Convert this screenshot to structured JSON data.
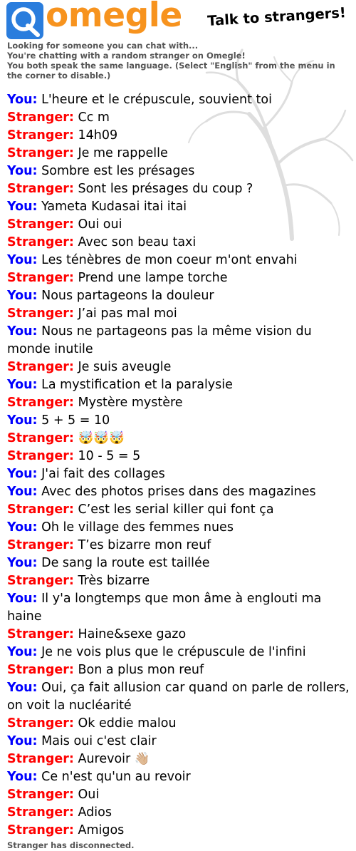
{
  "brand": {
    "name": "omegle",
    "tagline": "Talk to strangers!",
    "logo_icon": "omegle-logo-icon",
    "colors": {
      "logo_blue": "#2a7ddd",
      "logo_orange": "#f7931e",
      "you": "#0000ff",
      "stranger": "#ff0000",
      "status": "#555555"
    }
  },
  "status": {
    "line1": "Looking for someone you can chat with...",
    "line2": "You're chatting with a random stranger on Omegle!",
    "line3": "You both speak the same language. (Select \"English\" from the menu in the corner to disable.)",
    "disconnected": "Stranger has disconnected."
  },
  "chat": [
    {
      "who": "You:",
      "role": "you",
      "text": "L'heure et le crépuscule, souvient toi"
    },
    {
      "who": "Stranger:",
      "role": "stranger",
      "text": "Cc m"
    },
    {
      "who": "Stranger:",
      "role": "stranger",
      "text": "14h09"
    },
    {
      "who": "Stranger:",
      "role": "stranger",
      "text": "Je me rappelle"
    },
    {
      "who": "You:",
      "role": "you",
      "text": "Sombre est les présages"
    },
    {
      "who": "Stranger:",
      "role": "stranger",
      "text": "Sont les présages du coup ?"
    },
    {
      "who": "You:",
      "role": "you",
      "text": "Yameta Kudasai itai itai"
    },
    {
      "who": "Stranger:",
      "role": "stranger",
      "text": "Oui oui"
    },
    {
      "who": "Stranger:",
      "role": "stranger",
      "text": "Avec son beau taxi"
    },
    {
      "who": "You:",
      "role": "you",
      "text": "Les ténèbres de mon coeur m'ont envahi"
    },
    {
      "who": "Stranger:",
      "role": "stranger",
      "text": "Prend une lampe torche"
    },
    {
      "who": "You:",
      "role": "you",
      "text": "Nous partageons la douleur"
    },
    {
      "who": "Stranger:",
      "role": "stranger",
      "text": "J’ai pas mal moi"
    },
    {
      "who": "You:",
      "role": "you",
      "text": "Nous ne partageons pas la même vision du monde inutile"
    },
    {
      "who": "Stranger:",
      "role": "stranger",
      "text": "Je suis aveugle"
    },
    {
      "who": "You:",
      "role": "you",
      "text": "La mystification et la paralysie"
    },
    {
      "who": "Stranger:",
      "role": "stranger",
      "text": "Mystère mystère"
    },
    {
      "who": "You:",
      "role": "you",
      "text": "5 + 5 = 10"
    },
    {
      "who": "Stranger:",
      "role": "stranger",
      "text": "🤯🤯🤯"
    },
    {
      "who": "Stranger:",
      "role": "stranger",
      "text": "10 - 5 = 5"
    },
    {
      "who": "You:",
      "role": "you",
      "text": "J'ai fait des collages"
    },
    {
      "who": "You:",
      "role": "you",
      "text": "Avec des photos prises dans des magazines"
    },
    {
      "who": "Stranger:",
      "role": "stranger",
      "text": "C’est les serial killer qui font ça"
    },
    {
      "who": "You:",
      "role": "you",
      "text": "Oh le village des femmes nues"
    },
    {
      "who": "Stranger:",
      "role": "stranger",
      "text": "T’es bizarre mon reuf"
    },
    {
      "who": "You:",
      "role": "you",
      "text": "De sang la route est taillée"
    },
    {
      "who": "Stranger:",
      "role": "stranger",
      "text": "Très bizarre"
    },
    {
      "who": "You:",
      "role": "you",
      "text": "Il y'a longtemps que mon âme à englouti ma haine"
    },
    {
      "who": "Stranger:",
      "role": "stranger",
      "text": "Haine&sexe gazo"
    },
    {
      "who": "You:",
      "role": "you",
      "text": "Je ne vois plus que le crépuscule de l'infini"
    },
    {
      "who": "Stranger:",
      "role": "stranger",
      "text": "Bon a plus mon reuf"
    },
    {
      "who": "You:",
      "role": "you",
      "text": "Oui, ça fait allusion car quand on parle de rollers, on voit la nucléarité"
    },
    {
      "who": "Stranger:",
      "role": "stranger",
      "text": "Ok eddie malou"
    },
    {
      "who": "You:",
      "role": "you",
      "text": "Mais oui c'est clair"
    },
    {
      "who": "Stranger:",
      "role": "stranger",
      "text": "Aurevoir 👋🏼"
    },
    {
      "who": "You:",
      "role": "you",
      "text": "Ce n'est qu'un au revoir"
    },
    {
      "who": "Stranger:",
      "role": "stranger",
      "text": "Oui"
    },
    {
      "who": "Stranger:",
      "role": "stranger",
      "text": "Adios"
    },
    {
      "who": "Stranger:",
      "role": "stranger",
      "text": "Amigos"
    }
  ]
}
